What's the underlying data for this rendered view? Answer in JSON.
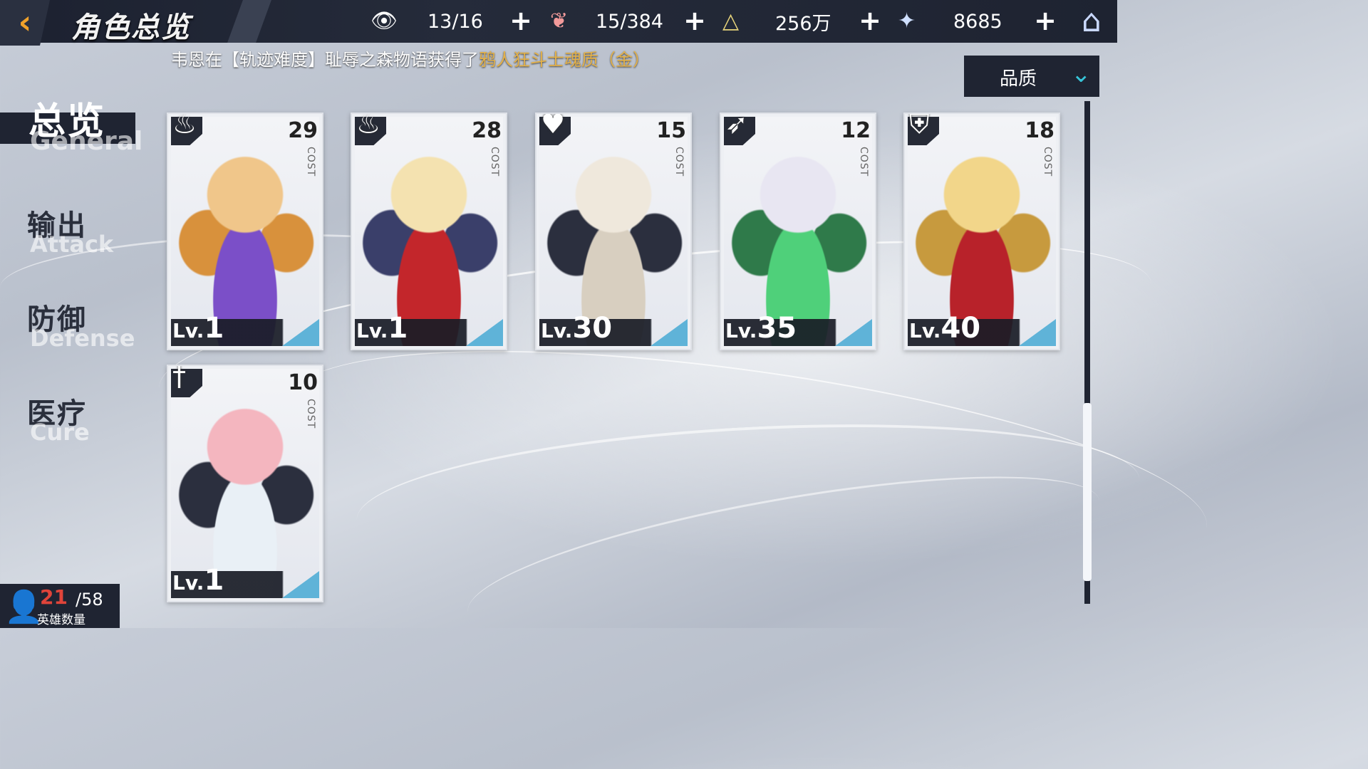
{
  "header": {
    "title": "角色总览",
    "back_icon": "back-arrow-icon",
    "resources": [
      {
        "icon": "eye-icon",
        "value": "13/16"
      },
      {
        "icon": "flame-heart-icon",
        "value": "15/384"
      },
      {
        "icon": "crystal-triangle-icon",
        "value": "256万"
      },
      {
        "icon": "star-icon",
        "value": "8685"
      }
    ],
    "home_icon": "home-icon"
  },
  "ticker": {
    "text": "韦恩在【轨迹难度】耻辱之森物语获得了",
    "highlight": "鸦人狂斗士魂质（金）"
  },
  "sort": {
    "label": "品质",
    "icon": "chevron-down-icon"
  },
  "nav": [
    {
      "cn": "总览",
      "en": "General",
      "active": true
    },
    {
      "cn": "输出",
      "en": "Attack",
      "active": false
    },
    {
      "cn": "防御",
      "en": "Defense",
      "active": false
    },
    {
      "cn": "医疗",
      "en": "Cure",
      "active": false
    }
  ],
  "cards": [
    {
      "cost": "29",
      "cost_label": "COST",
      "lv_prefix": "Lv.",
      "level": "1",
      "class_icon": "fire-class-icon",
      "palette": [
        "#f0c68a",
        "#7b4fc8",
        "#d8913c"
      ]
    },
    {
      "cost": "28",
      "cost_label": "COST",
      "lv_prefix": "Lv.",
      "level": "1",
      "class_icon": "fire-class-icon",
      "palette": [
        "#f4e2b0",
        "#c3262b",
        "#3a3f6a"
      ]
    },
    {
      "cost": "15",
      "cost_label": "COST",
      "lv_prefix": "Lv.",
      "level": "30",
      "class_icon": "heart-class-icon",
      "palette": [
        "#efe8dc",
        "#d8cfc0",
        "#2b2f3e"
      ]
    },
    {
      "cost": "12",
      "cost_label": "COST",
      "lv_prefix": "Lv.",
      "level": "35",
      "class_icon": "bow-class-icon",
      "palette": [
        "#e8e6f2",
        "#4fd07a",
        "#2f7a4a"
      ]
    },
    {
      "cost": "18",
      "cost_label": "COST",
      "lv_prefix": "Lv.",
      "level": "40",
      "class_icon": "shield-class-icon",
      "palette": [
        "#f2d68a",
        "#b8222a",
        "#c79a3e"
      ]
    },
    {
      "cost": "10",
      "cost_label": "COST",
      "lv_prefix": "Lv.",
      "level": "1",
      "class_icon": "sword-class-icon",
      "palette": [
        "#f4b6bf",
        "#e9f0f6",
        "#2b2f3e"
      ]
    }
  ],
  "hero_count": {
    "current": "21",
    "max": "/58",
    "label": "英雄数量",
    "icon": "person-icon"
  }
}
